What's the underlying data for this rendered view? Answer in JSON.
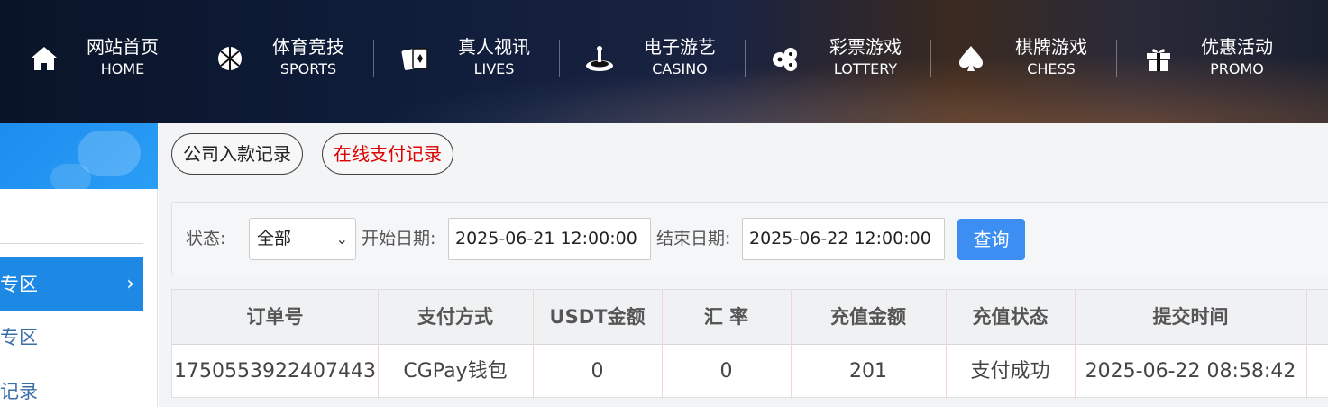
{
  "nav": [
    {
      "cn": "网站首页",
      "en": "HOME",
      "icon": "home-icon"
    },
    {
      "cn": "体育竞技",
      "en": "SPORTS",
      "icon": "basketball-icon"
    },
    {
      "cn": "真人视讯",
      "en": "LIVES",
      "icon": "cards-icon"
    },
    {
      "cn": "电子游艺",
      "en": "CASINO",
      "icon": "roulette-icon"
    },
    {
      "cn": "彩票游戏",
      "en": "LOTTERY",
      "icon": "lottery-balls-icon"
    },
    {
      "cn": "棋牌游戏",
      "en": "CHESS",
      "icon": "spade-icon"
    },
    {
      "cn": "优惠活动",
      "en": "PROMO",
      "icon": "gift-icon"
    }
  ],
  "sidebar": {
    "active_label": "专区",
    "item_1": "专区",
    "item_2": "记录"
  },
  "tabs": [
    {
      "label": "公司入款记录",
      "active": false
    },
    {
      "label": "在线支付记录",
      "active": true
    }
  ],
  "filter": {
    "status_label": "状态:",
    "status_value": "全部",
    "start_label": "开始日期:",
    "start_value": "2025-06-21 12:00:00",
    "end_label": "结束日期:",
    "end_value": "2025-06-22 12:00:00",
    "query_button": "查询"
  },
  "table": {
    "headers": [
      "订单号",
      "支付方式",
      "USDT金额",
      "汇 率",
      "充值金额",
      "充值状态",
      "提交时间"
    ],
    "rows": [
      [
        "1750553922407443",
        "CGPay钱包",
        "0",
        "0",
        "201",
        "支付成功",
        "2025-06-22 08:58:42"
      ]
    ]
  },
  "colors": {
    "accent": "#1e88e5",
    "query_button": "#3d8ef2",
    "active_tab_text": "#dd0000"
  }
}
